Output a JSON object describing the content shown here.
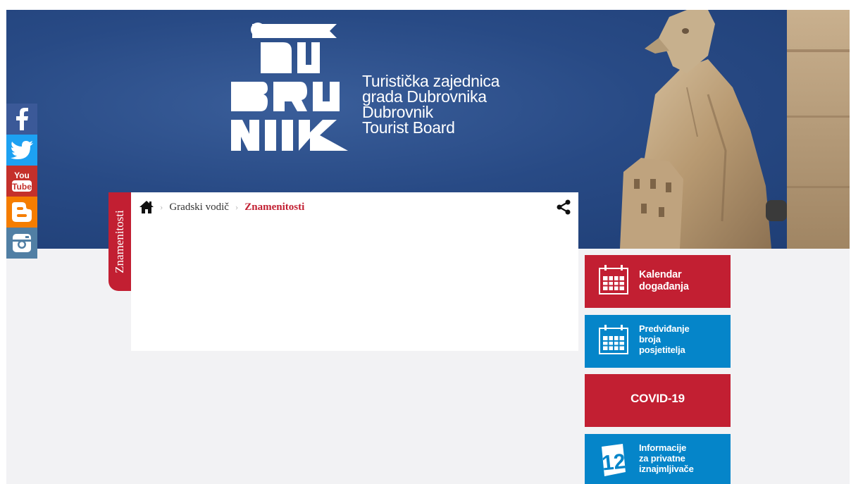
{
  "logo": {
    "lines": [
      "Turistička zajednica",
      "grada Dubrovnika",
      "Dubrovnik",
      "Tourist Board"
    ],
    "wordmark": "DUBROVNIK"
  },
  "social": [
    {
      "name": "facebook-icon",
      "color": "#3b5998"
    },
    {
      "name": "twitter-icon",
      "color": "#1da1f2"
    },
    {
      "name": "youtube-icon",
      "color": "#c4302b"
    },
    {
      "name": "blogger-icon",
      "color": "#f57d00"
    },
    {
      "name": "instagram-icon",
      "color": "#517fa4"
    }
  ],
  "breadcrumb": {
    "side_tab": "Znamenitosti",
    "items": [
      "Gradski vodič",
      "Znamenitosti"
    ]
  },
  "tiles": {
    "kalendar": {
      "line1": "Kalendar",
      "line2": "događanja"
    },
    "predvidanje": {
      "line1": "Predviđanje",
      "line2": "broja",
      "line3": "posjetitelja"
    },
    "covid": {
      "label": "COVID-19"
    },
    "info": {
      "line1": "Informacije",
      "line2": "za privatne",
      "line3": "iznajmljivače"
    }
  },
  "colors": {
    "brand_red": "#c21f32",
    "brand_blue": "#0585c9",
    "hero_blue": "#284a85"
  }
}
